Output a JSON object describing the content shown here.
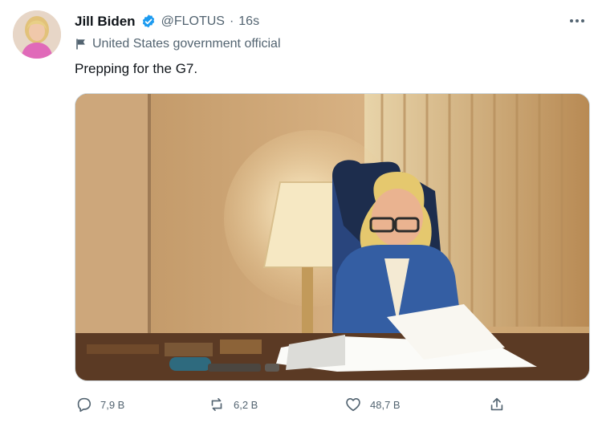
{
  "tweet": {
    "author_name": "Jill Biden",
    "handle": "@FLOTUS",
    "separator": "·",
    "time": "16s",
    "label": "United States government official",
    "text": "Prepping for the G7."
  },
  "actions": {
    "reply_count": "7,9 В",
    "retweet_count": "6,2 В",
    "like_count": "48,7 В"
  },
  "icons": {
    "verified": "verified-badge-icon",
    "flag": "flag-icon",
    "more": "more-horizontal-icon",
    "reply": "reply-icon",
    "retweet": "retweet-icon",
    "like": "heart-icon",
    "share": "share-icon"
  },
  "colors": {
    "verified_blue": "#1d9bf0",
    "secondary_text": "#536471"
  }
}
